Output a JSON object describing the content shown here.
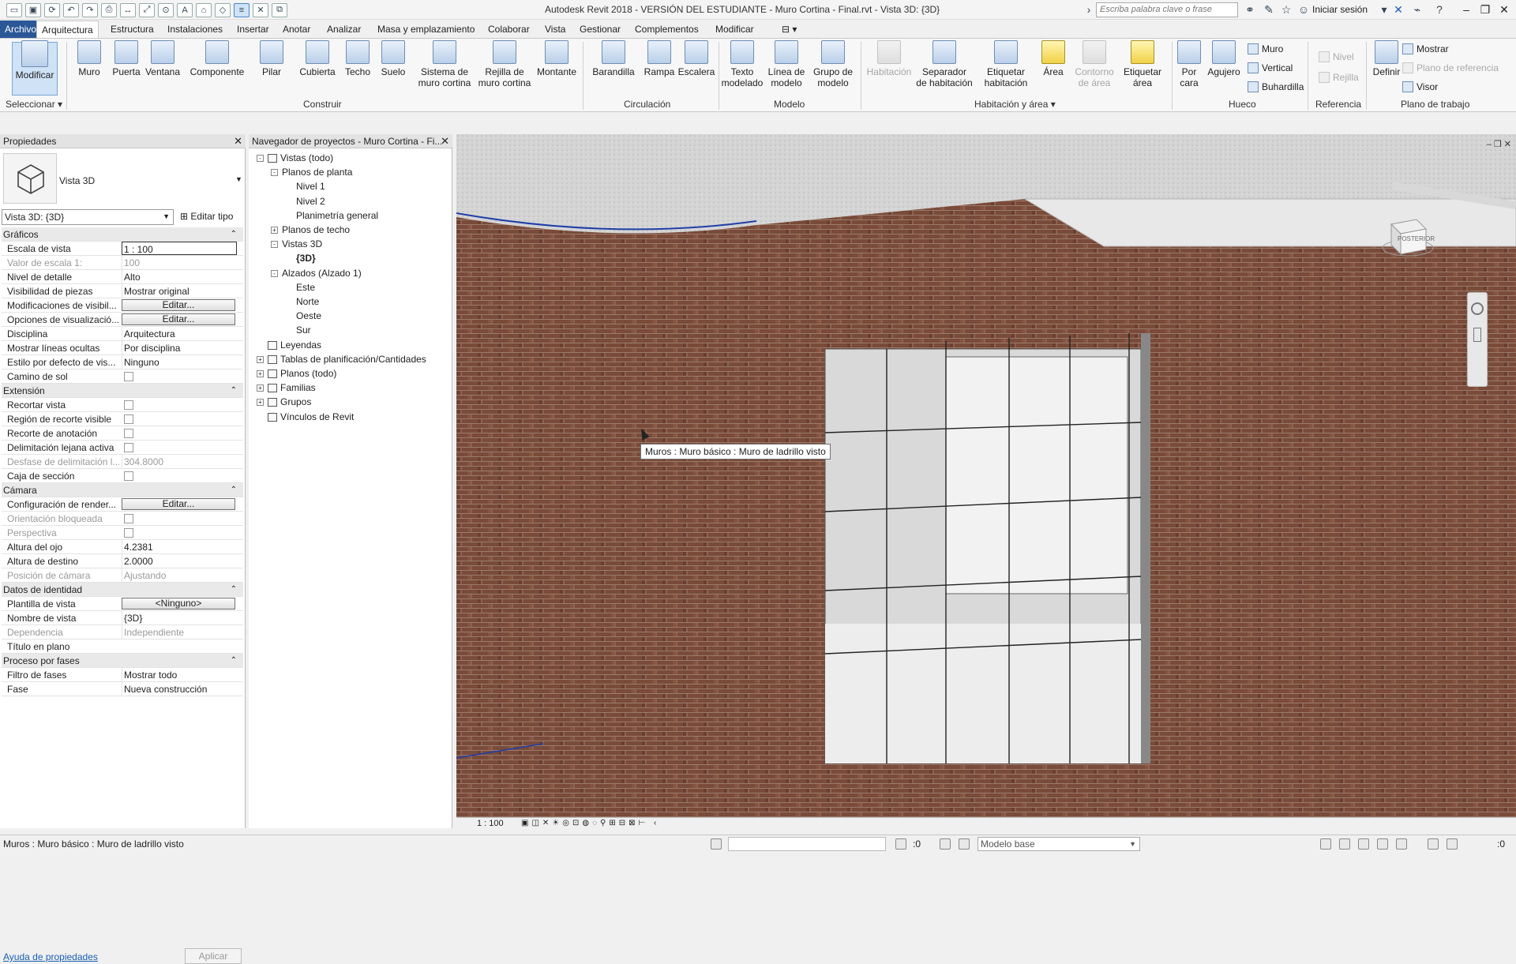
{
  "titlebar": {
    "title": "Autodesk Revit 2018 - VERSIÓN DEL ESTUDIANTE -    Muro Cortina - Final.rvt - Vista 3D: {3D}",
    "search_placeholder": "Escriba palabra clave o frase",
    "signin": "Iniciar sesión"
  },
  "menu": {
    "tabs": [
      "Archivo",
      "Arquitectura",
      "Estructura",
      "Instalaciones",
      "Insertar",
      "Anotar",
      "Analizar",
      "Masa y emplazamiento",
      "Colaborar",
      "Vista",
      "Gestionar",
      "Complementos",
      "Modificar"
    ]
  },
  "ribbon": {
    "select": {
      "button": "Modificar",
      "label": "Seleccionar"
    },
    "build": {
      "label": "Construir",
      "buttons": [
        "Muro",
        "Puerta",
        "Ventana",
        "Componente",
        "Pilar",
        "Cubierta",
        "Techo",
        "Suelo",
        "Sistema de\nmuro cortina",
        "Rejilla de\nmuro cortina",
        "Montante"
      ]
    },
    "circulation": {
      "label": "Circulación",
      "buttons": [
        "Barandilla",
        "Rampa",
        "Escalera"
      ]
    },
    "model": {
      "label": "Modelo",
      "buttons": [
        "Texto\nmodelado",
        "Línea de\nmodelo",
        "Grupo de\nmodelo"
      ]
    },
    "room_area": {
      "label": "Habitación y área",
      "buttons": [
        "Habitación",
        "Separador\nde habitación",
        "Etiquetar\nhabitación",
        "Área",
        "Contorno\nde área",
        "Etiquetar\nárea"
      ]
    },
    "opening": {
      "label": "Hueco",
      "buttons": [
        "Por\ncara",
        "Agujero"
      ],
      "small": [
        "Muro",
        "Vertical",
        "Buhardilla"
      ]
    },
    "datum": {
      "label": "Referencia",
      "small": [
        "Nivel",
        "Rejilla"
      ]
    },
    "workplane": {
      "label": "Plano de trabajo",
      "button": "Definir",
      "small": [
        "Mostrar",
        "Plano de referencia",
        "Visor"
      ]
    }
  },
  "properties": {
    "title": "Propiedades",
    "type_name": "Vista 3D",
    "view_selector": "Vista 3D: {3D}",
    "edit_type": "Editar tipo",
    "rows": [
      {
        "kind": "cat",
        "k": "Gráficos"
      },
      {
        "kind": "input",
        "k": "Escala de vista",
        "v": "1 : 100"
      },
      {
        "kind": "dis",
        "k": "Valor de escala    1:",
        "v": "100"
      },
      {
        "kind": "text",
        "k": "Nivel de detalle",
        "v": "Alto"
      },
      {
        "kind": "text",
        "k": "Visibilidad de piezas",
        "v": "Mostrar original"
      },
      {
        "kind": "edit",
        "k": "Modificaciones de visibil...",
        "v": "Editar..."
      },
      {
        "kind": "edit",
        "k": "Opciones de visualizació...",
        "v": "Editar..."
      },
      {
        "kind": "text",
        "k": "Disciplina",
        "v": "Arquitectura"
      },
      {
        "kind": "text",
        "k": "Mostrar líneas ocultas",
        "v": "Por disciplina"
      },
      {
        "kind": "text",
        "k": "Estilo por defecto de vis...",
        "v": "Ninguno"
      },
      {
        "kind": "chk",
        "k": "Camino de sol"
      },
      {
        "kind": "cat",
        "k": "Extensión"
      },
      {
        "kind": "chk",
        "k": "Recortar vista"
      },
      {
        "kind": "chk",
        "k": "Región de recorte visible"
      },
      {
        "kind": "chk",
        "k": "Recorte de anotación"
      },
      {
        "kind": "chk",
        "k": "Delimitación lejana activa"
      },
      {
        "kind": "dis",
        "k": "Desfase de delimitación l...",
        "v": "304.8000"
      },
      {
        "kind": "chk",
        "k": "Caja de sección"
      },
      {
        "kind": "cat",
        "k": "Cámara"
      },
      {
        "kind": "edit",
        "k": "Configuración de render...",
        "v": "Editar..."
      },
      {
        "kind": "chkdis",
        "k": "Orientación bloqueada"
      },
      {
        "kind": "chkdis",
        "k": "Perspectiva"
      },
      {
        "kind": "text",
        "k": "Altura del ojo",
        "v": "4.2381"
      },
      {
        "kind": "text",
        "k": "Altura de destino",
        "v": "2.0000"
      },
      {
        "kind": "dis",
        "k": "Posición de cámara",
        "v": "Ajustando"
      },
      {
        "kind": "cat",
        "k": "Datos de identidad"
      },
      {
        "kind": "edit",
        "k": "Plantilla de vista",
        "v": "<Ninguno>"
      },
      {
        "kind": "text",
        "k": "Nombre de vista",
        "v": "{3D}"
      },
      {
        "kind": "dis",
        "k": "Dependencia",
        "v": "Independiente"
      },
      {
        "kind": "text",
        "k": "Título en plano",
        "v": ""
      },
      {
        "kind": "cat",
        "k": "Proceso por fases"
      },
      {
        "kind": "text",
        "k": "Filtro de fases",
        "v": "Mostrar todo"
      },
      {
        "kind": "text",
        "k": "Fase",
        "v": "Nueva construcción"
      }
    ],
    "help": "Ayuda de propiedades",
    "apply": "Aplicar"
  },
  "browser": {
    "title": "Navegador de proyectos - Muro Cortina - Fi...",
    "nodes": [
      {
        "label": "Vistas (todo)",
        "lvl": 0,
        "box": "-"
      },
      {
        "label": "Planos de planta",
        "lvl": 1,
        "box": "-"
      },
      {
        "label": "Nivel 1",
        "lvl": 2,
        "box": ""
      },
      {
        "label": "Nivel 2",
        "lvl": 2,
        "box": ""
      },
      {
        "label": "Planimetría general",
        "lvl": 2,
        "box": ""
      },
      {
        "label": "Planos de techo",
        "lvl": 1,
        "box": "+"
      },
      {
        "label": "Vistas 3D",
        "lvl": 1,
        "box": "-"
      },
      {
        "label": "{3D}",
        "lvl": 2,
        "box": "",
        "bold": true
      },
      {
        "label": "Alzados (Alzado 1)",
        "lvl": 1,
        "box": "-"
      },
      {
        "label": "Este",
        "lvl": 2,
        "box": ""
      },
      {
        "label": "Norte",
        "lvl": 2,
        "box": ""
      },
      {
        "label": "Oeste",
        "lvl": 2,
        "box": ""
      },
      {
        "label": "Sur",
        "lvl": 2,
        "box": ""
      },
      {
        "label": "Leyendas",
        "lvl": 0,
        "box": ""
      },
      {
        "label": "Tablas de planificación/Cantidades",
        "lvl": 0,
        "box": "+"
      },
      {
        "label": "Planos (todo)",
        "lvl": 0,
        "box": "+"
      },
      {
        "label": "Familias",
        "lvl": 0,
        "box": "+"
      },
      {
        "label": "Grupos",
        "lvl": 0,
        "box": "+"
      },
      {
        "label": "Vínculos de Revit",
        "lvl": 0,
        "box": ""
      }
    ]
  },
  "viewport": {
    "tooltip": "Muros : Muro básico : Muro de ladrillo visto",
    "viewcube_label": "POSTERIOR",
    "scale": "1 : 100"
  },
  "status": {
    "text": "Muros : Muro básico : Muro de ladrillo visto",
    "zero": ":0",
    "model": "Modelo base",
    "filter_zero": ":0"
  },
  "colors": {
    "accent": "#2b5797",
    "brick": "#7a4b3a",
    "glass": "#dedede"
  }
}
